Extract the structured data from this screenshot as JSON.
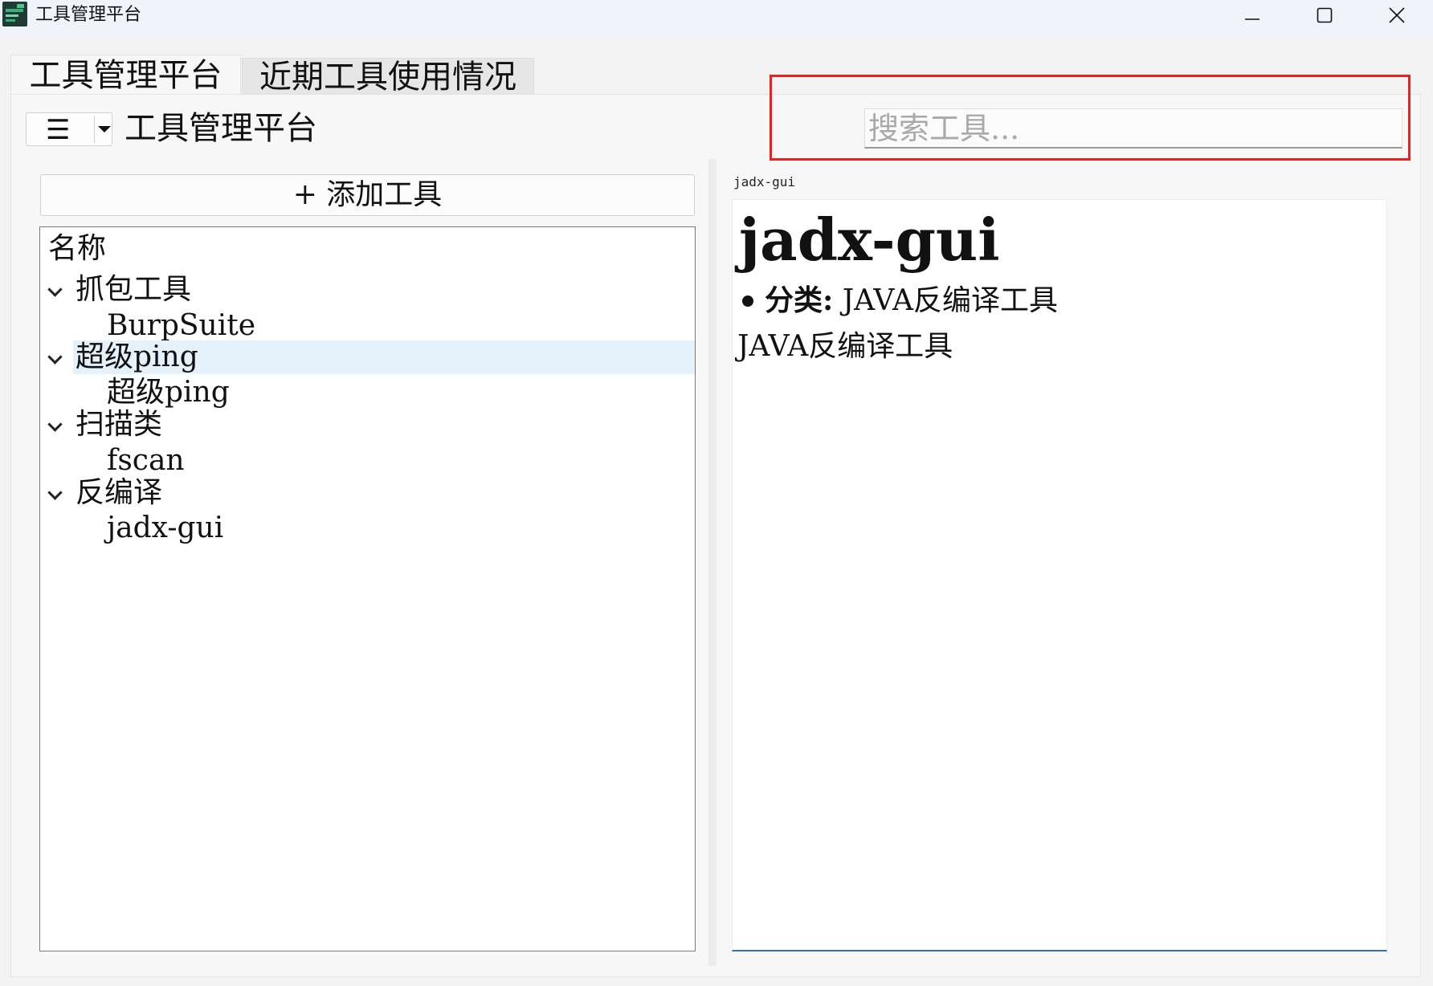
{
  "window": {
    "title": "工具管理平台",
    "controls": {
      "minimize": "minimize-icon",
      "maximize": "maximize-icon",
      "close": "close-icon"
    }
  },
  "tabs": [
    {
      "label": "工具管理平台",
      "active": true
    },
    {
      "label": "近期工具使用情况",
      "active": false
    }
  ],
  "toolbar": {
    "menu_icon": "☰",
    "title": "工具管理平台",
    "search_placeholder": "搜索工具..."
  },
  "left": {
    "add_button_label": "+ 添加工具",
    "tree_header": "名称",
    "categories": [
      {
        "label": "抓包工具",
        "items": [
          "BurpSuite"
        ],
        "expanded": true
      },
      {
        "label": "超级ping",
        "items": [
          "超级ping"
        ],
        "expanded": true,
        "selected": true
      },
      {
        "label": "扫描类",
        "items": [
          "fscan"
        ],
        "expanded": true
      },
      {
        "label": "反编译",
        "items": [
          "jadx-gui"
        ],
        "expanded": true
      }
    ]
  },
  "detail": {
    "label": "jadx-gui",
    "title": "jadx-gui",
    "category_key": "分类:",
    "category_value": "JAVA反编译工具",
    "description": "JAVA反编译工具"
  },
  "colors": {
    "highlight_box": "#f01e1e",
    "selection_bg": "#e5f1fb",
    "accent_underline": "#2f6bd0"
  }
}
